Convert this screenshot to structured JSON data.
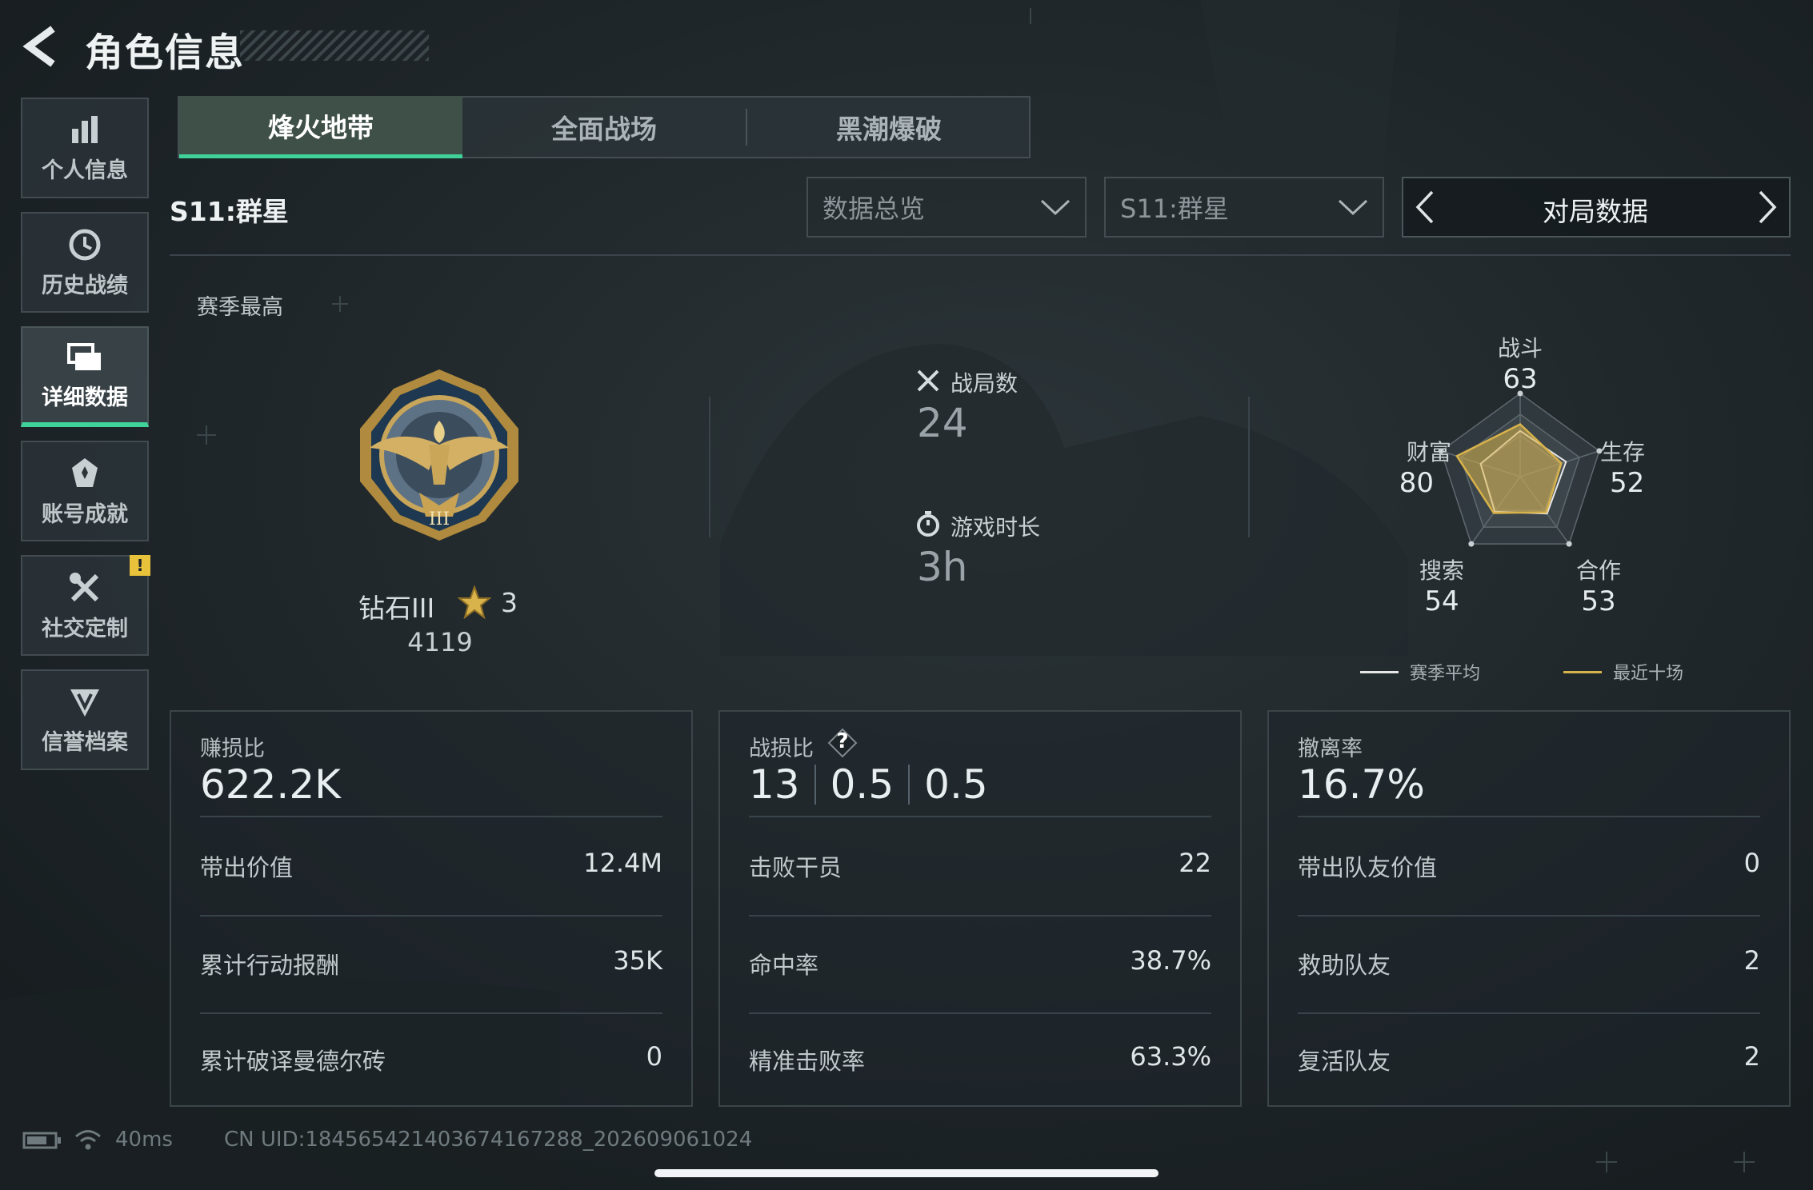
{
  "header": {
    "title": "角色信息"
  },
  "sidebar": {
    "items": [
      {
        "label": "个人信息",
        "icon": "bar-chart-icon"
      },
      {
        "label": "历史战绩",
        "icon": "history-clock-icon"
      },
      {
        "label": "详细数据",
        "icon": "cards-icon",
        "active": true
      },
      {
        "label": "账号成就",
        "icon": "achievement-icon"
      },
      {
        "label": "社交定制",
        "icon": "tools-icon",
        "badge": "!"
      },
      {
        "label": "信誉档案",
        "icon": "reputation-icon"
      }
    ]
  },
  "tabs": [
    {
      "label": "烽火地带",
      "active": true
    },
    {
      "label": "全面战场"
    },
    {
      "label": "黑潮爆破"
    }
  ],
  "season_label": "S11:群星",
  "filters": {
    "data_type": "数据总览",
    "season": "S11:群星",
    "pager_label": "对局数据"
  },
  "season_best": {
    "title": "赛季最高",
    "rank_name": "钻石III",
    "stars": "3",
    "points": "4119",
    "badge_numeral": "III"
  },
  "summary": {
    "matches_label": "战局数",
    "matches_value": "24",
    "playtime_label": "游戏时长",
    "playtime_value": "3h"
  },
  "radar": {
    "axes": [
      {
        "label": "战斗",
        "value": "63"
      },
      {
        "label": "生存",
        "value": "52"
      },
      {
        "label": "合作",
        "value": "53"
      },
      {
        "label": "搜索",
        "value": "54"
      },
      {
        "label": "财富",
        "value": "80"
      }
    ],
    "recent_values": [
      0.63,
      0.52,
      0.53,
      0.54,
      0.8
    ],
    "average_values": [
      0.55,
      0.58,
      0.55,
      0.52,
      0.5
    ],
    "legend": [
      {
        "label": "赛季平均",
        "color": "#e6e6e6"
      },
      {
        "label": "最近十场",
        "color": "#d8b24a"
      }
    ]
  },
  "cards": [
    {
      "title": "赚损比",
      "value": "622.2K",
      "rows": [
        {
          "label": "带出价值",
          "value": "12.4M"
        },
        {
          "label": "累计行动报酬",
          "value": "35K"
        },
        {
          "label": "累计破译曼德尔砖",
          "value": "0"
        }
      ]
    },
    {
      "title": "战损比",
      "help": "?",
      "value_parts": [
        "13",
        "0.5",
        "0.5"
      ],
      "rows": [
        {
          "label": "击败干员",
          "value": "22"
        },
        {
          "label": "命中率",
          "value": "38.7%"
        },
        {
          "label": "精准击败率",
          "value": "63.3%"
        }
      ]
    },
    {
      "title": "撤离率",
      "value": "16.7%",
      "rows": [
        {
          "label": "带出队友价值",
          "value": "0"
        },
        {
          "label": "救助队友",
          "value": "2"
        },
        {
          "label": "复活队友",
          "value": "2"
        }
      ]
    }
  ],
  "footer": {
    "latency": "40ms",
    "uid": "CN UID:1845654214036741672​88_202609061024"
  },
  "colors": {
    "accent": "#3fd39a",
    "gold": "#d8b24a",
    "warning": "#e8c23a"
  }
}
